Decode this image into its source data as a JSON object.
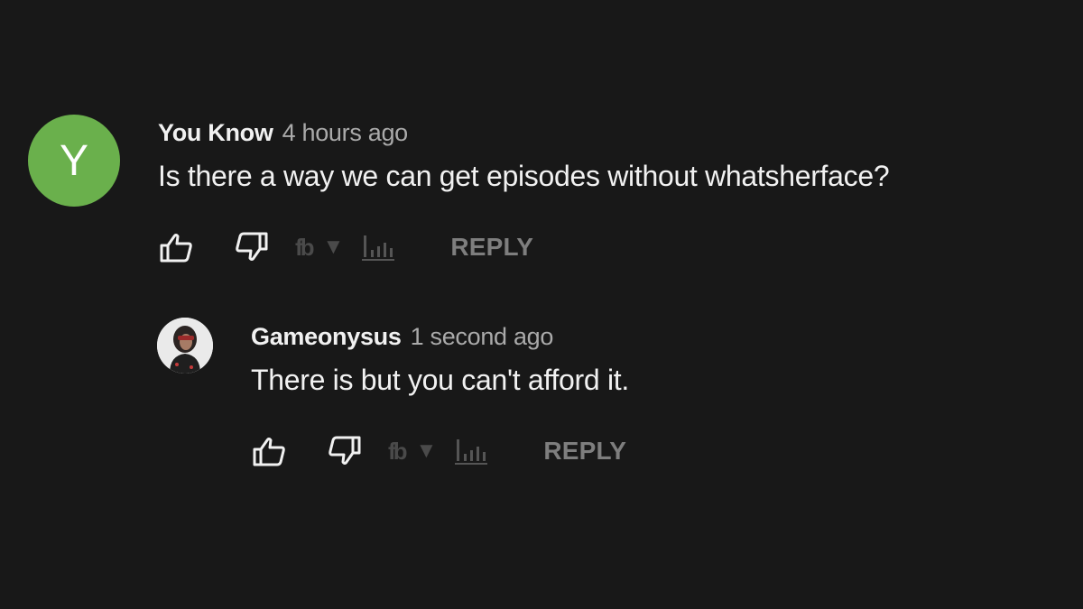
{
  "comments": [
    {
      "avatar": {
        "letter": "Y",
        "color": "#6ab04c"
      },
      "author": "You Know",
      "time": "4 hours ago",
      "text": "Is there a way we can get episodes without whatsherface?",
      "actions": {
        "like_icon": "thumbs-up-icon",
        "dislike_icon": "thumbs-down-icon",
        "extension_icon": "fb",
        "extension_arrow": "▼",
        "stats_icon": "bar-chart-icon",
        "reply_label": "REPLY"
      }
    },
    {
      "avatar": {
        "type": "photo"
      },
      "author": "Gameonysus",
      "time": "1 second ago",
      "text": "There is but you can't afford it.",
      "actions": {
        "like_icon": "thumbs-up-icon",
        "dislike_icon": "thumbs-down-icon",
        "extension_icon": "fb",
        "extension_arrow": "▼",
        "stats_icon": "bar-chart-icon",
        "reply_label": "REPLY"
      }
    }
  ],
  "colors": {
    "background": "#181818",
    "primary_text": "#f1f1f1",
    "secondary_text": "#aaaaaa",
    "reply_text": "#7e7e7e"
  }
}
